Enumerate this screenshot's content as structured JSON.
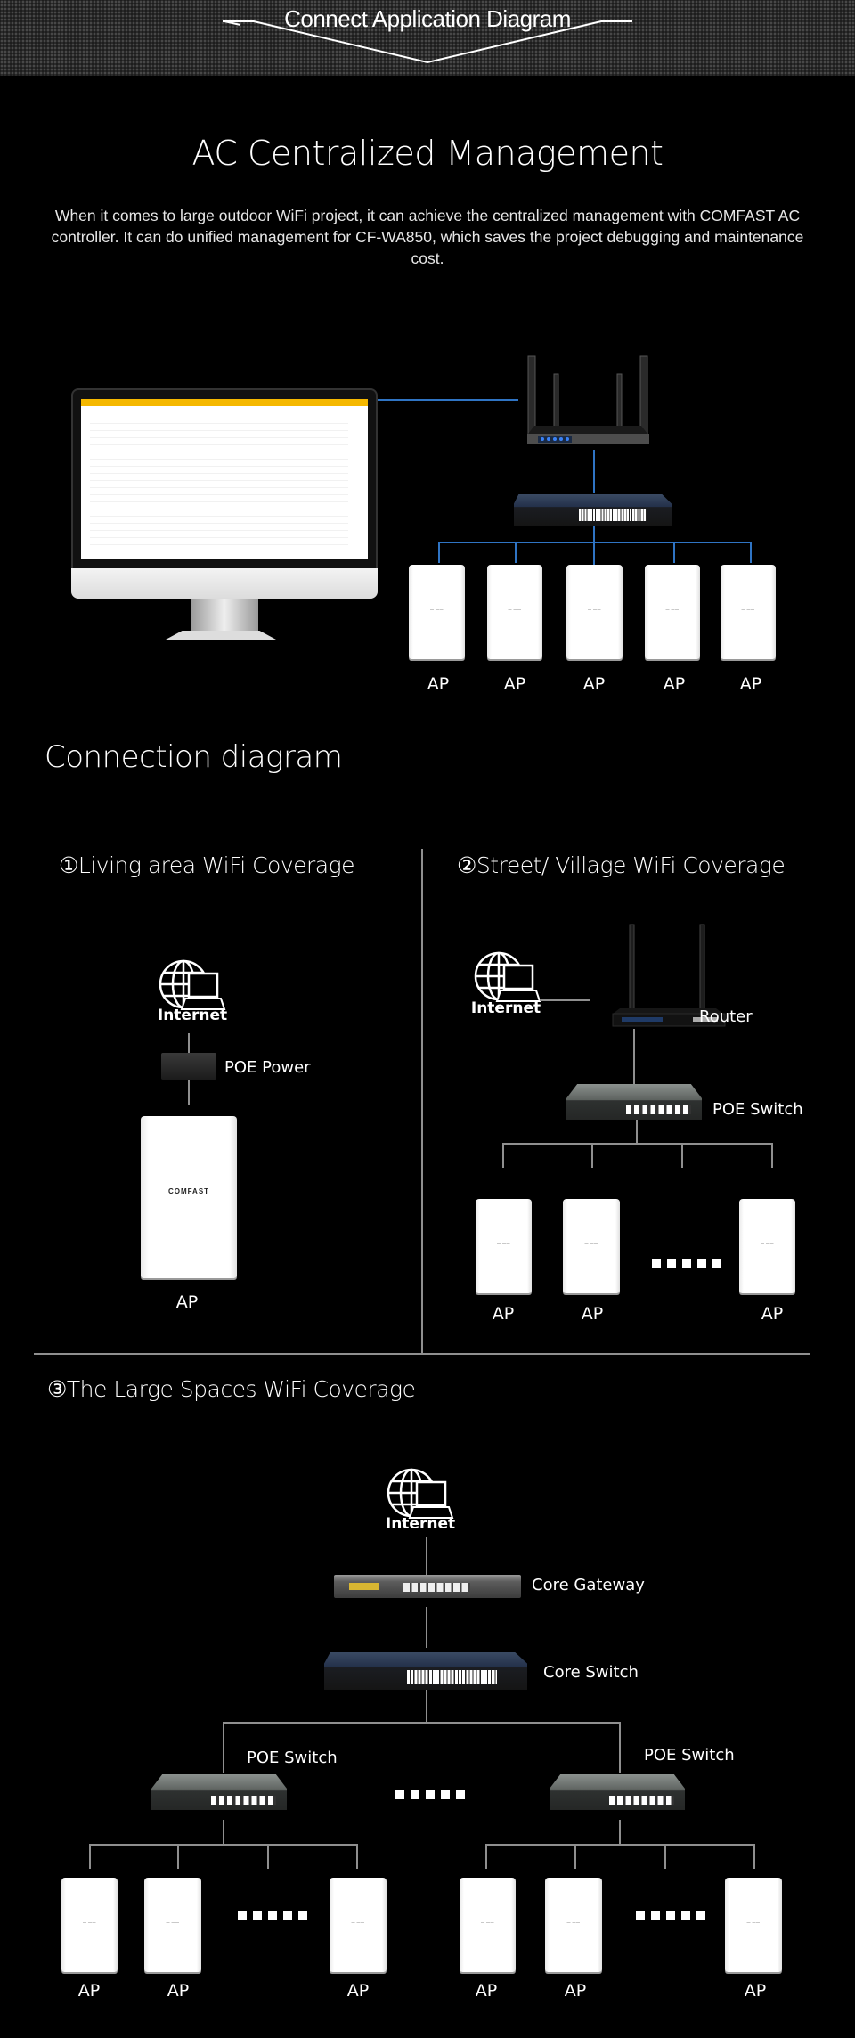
{
  "banner": {
    "title": "Connect Application Diagram"
  },
  "ac_section": {
    "title": "AC Centralized Management",
    "description": "When it comes to large outdoor WiFi project, it can achieve the centralized management with COMFAST AC controller. It can do unified management for CF-WA850, which saves the project debugging and maintenance cost.",
    "ap_labels": [
      "AP",
      "AP",
      "AP",
      "AP",
      "AP"
    ]
  },
  "connection_section": {
    "title": "Connection diagram",
    "scenario1": {
      "title": "①Living area WiFi Coverage",
      "internet_label": "Internet",
      "poe_power_label": "POE Power",
      "ap_label": "AP",
      "ap_brand": "COMFAST"
    },
    "scenario2": {
      "title": "②Street/ Village WiFi Coverage",
      "internet_label": "Internet",
      "router_label": "Router",
      "poe_switch_label": "POE Switch",
      "ap_labels": [
        "AP",
        "AP",
        "AP"
      ]
    },
    "scenario3": {
      "title": "③The Large Spaces WiFi Coverage",
      "internet_label": "Internet",
      "core_gateway_label": "Core Gateway",
      "core_switch_label": "Core Switch",
      "poe_switch_left_label": "POE Switch",
      "poe_switch_right_label": "POE Switch",
      "left_ap_labels": [
        "AP",
        "AP",
        "AP"
      ],
      "right_ap_labels": [
        "AP",
        "AP",
        "AP"
      ]
    }
  },
  "colors": {
    "background": "#000000",
    "ac_link": "#2f74c4",
    "diagram_link": "#8f8f8f",
    "text": "#ffffff"
  }
}
